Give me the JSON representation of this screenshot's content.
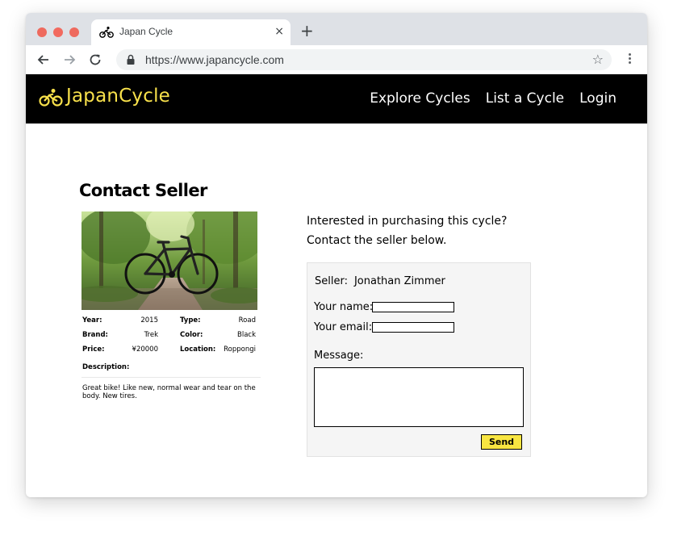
{
  "browser": {
    "tab_title": "Japan Cycle",
    "tab_close": "×",
    "new_tab": "+",
    "url": "https://www.japancycle.com",
    "bookmark": "☆"
  },
  "site": {
    "logo_text": "JapanCycle",
    "brand_color": "#f8e14b",
    "nav": [
      "Explore Cycles",
      "List a Cycle",
      "Login"
    ]
  },
  "listing": {
    "title": "Contact Seller",
    "specs": [
      {
        "left_label": "Year:",
        "left_value": "2015",
        "right_label": "Type:",
        "right_value": "Road"
      },
      {
        "left_label": "Brand:",
        "left_value": "Trek",
        "right_label": "Color:",
        "right_value": "Black"
      },
      {
        "left_label": "Price:",
        "left_value": "¥20000",
        "right_label": "Location:",
        "right_value": "Roppongi"
      }
    ],
    "description_label": "Description:",
    "description": "Great bike! Like new, normal wear and tear on the body. New tires."
  },
  "contact": {
    "intro_line1": "Interested in purchasing this cycle?",
    "intro_line2": "Contact the seller below.",
    "seller_label": "Seller:",
    "seller_name": "Jonathan Zimmer",
    "name_label": "Your name:",
    "name_value": "",
    "email_label": "Your email:",
    "email_value": "",
    "message_label": "Message:",
    "message_value": "",
    "send_label": "Send",
    "send_color": "#f8e541"
  }
}
